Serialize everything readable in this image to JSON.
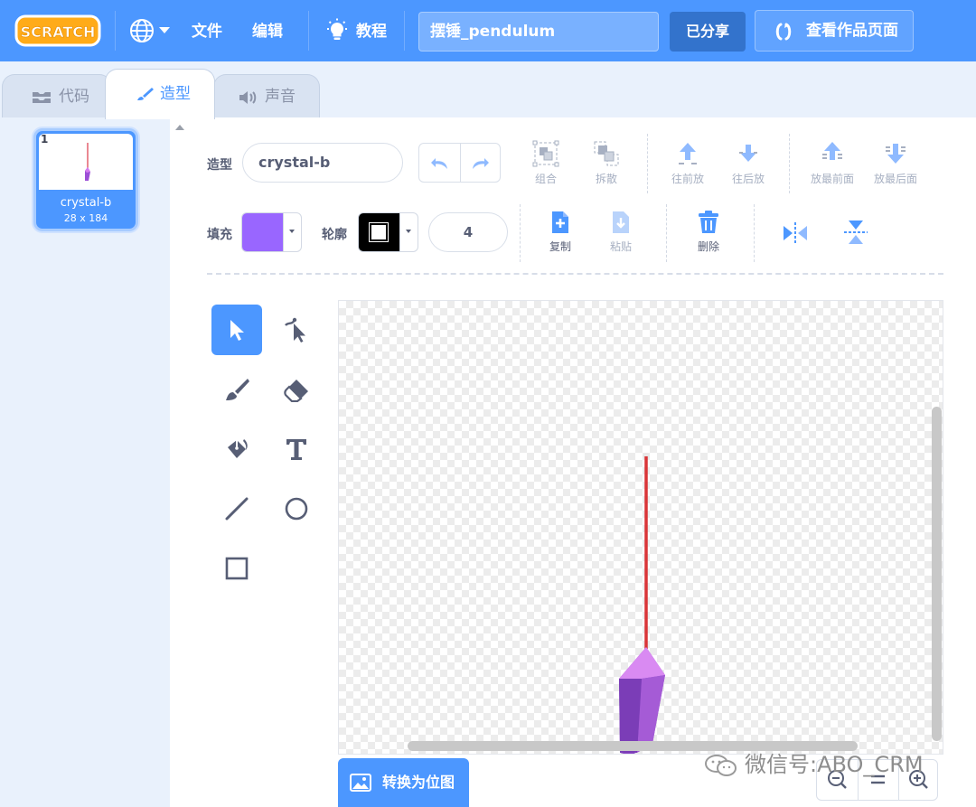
{
  "menubar": {
    "logo_text": "SCRATCH",
    "file_label": "文件",
    "edit_label": "编辑",
    "tutorials_label": "教程",
    "project_title": "摆锤_pendulum",
    "share_label": "已分享",
    "see_project_page_label": "查看作品页面",
    "bg_color": "#4c97ff"
  },
  "tabs": [
    {
      "label": "代码",
      "icon": "code-icon",
      "active": false
    },
    {
      "label": "造型",
      "icon": "brush-icon",
      "active": true
    },
    {
      "label": "声音",
      "icon": "speaker-icon",
      "active": false
    }
  ],
  "costume_list": {
    "items": [
      {
        "number": "1",
        "name": "crystal-b",
        "size": "28 x 184",
        "selected": true
      }
    ]
  },
  "paint_editor": {
    "costume_label": "造型",
    "costume_name": "crystal-b",
    "group_label": "组合",
    "ungroup_label": "拆散",
    "forward_label": "往前放",
    "backward_label": "往后放",
    "front_label": "放最前面",
    "back_label": "放最后面",
    "fill_label": "填充",
    "fill_color": "#9966ff",
    "outline_label": "轮廓",
    "outline_color": "#000000",
    "stroke_width": "4",
    "copy_label": "复制",
    "paste_label": "粘贴",
    "delete_label": "删除",
    "convert_bitmap_label": "转换为位图",
    "tools": [
      "select-tool",
      "reshape-tool",
      "brush-tool",
      "eraser-tool",
      "fill-tool",
      "text-tool",
      "line-tool",
      "circle-tool",
      "rectangle-tool"
    ],
    "selected_tool": "select-tool"
  },
  "watermark": {
    "text": "微信号:ABO_CRM"
  }
}
